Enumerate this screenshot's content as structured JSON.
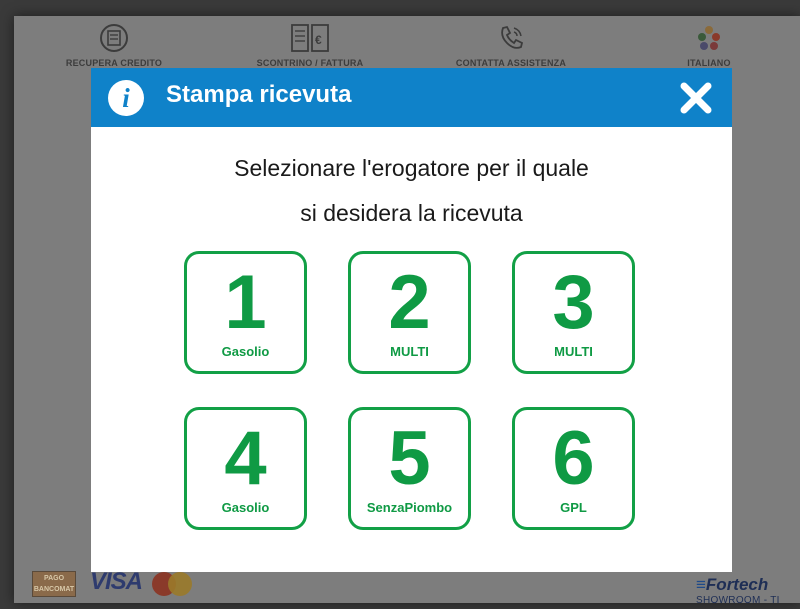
{
  "topbar": {
    "items": [
      {
        "label": "RECUPERA CREDITO"
      },
      {
        "label": "SCONTRINO / FATTURA"
      },
      {
        "label": "CONTATTA ASSISTENZA"
      },
      {
        "label": "ITALIANO"
      }
    ]
  },
  "modal": {
    "title": "Stampa ricevuta",
    "prompt_line1": "Selezionare l'erogatore per il quale",
    "prompt_line2": "si desidera la ricevuta",
    "pumps": [
      {
        "number": "1",
        "fuel": "Gasolio"
      },
      {
        "number": "2",
        "fuel": "MULTI"
      },
      {
        "number": "3",
        "fuel": "MULTI"
      },
      {
        "number": "4",
        "fuel": "Gasolio"
      },
      {
        "number": "5",
        "fuel": "SenzaPiombo"
      },
      {
        "number": "6",
        "fuel": "GPL"
      }
    ]
  },
  "footer": {
    "bancomat_line1": "PAGO",
    "bancomat_line2": "BANCOMAT",
    "visa": "VISA",
    "brand": "Fortech",
    "brand_sub": "SHOWROOM - TI"
  },
  "colors": {
    "header_blue": "#0f82c9",
    "pump_green": "#0f9a44",
    "overlay_gray": "#7d7d7d"
  },
  "icons": {
    "info": "info-icon",
    "close": "close-icon",
    "credit": "credit-recovery-icon",
    "receipt": "receipt-invoice-icon",
    "support": "phone-support-icon",
    "language": "flags-language-icon"
  }
}
